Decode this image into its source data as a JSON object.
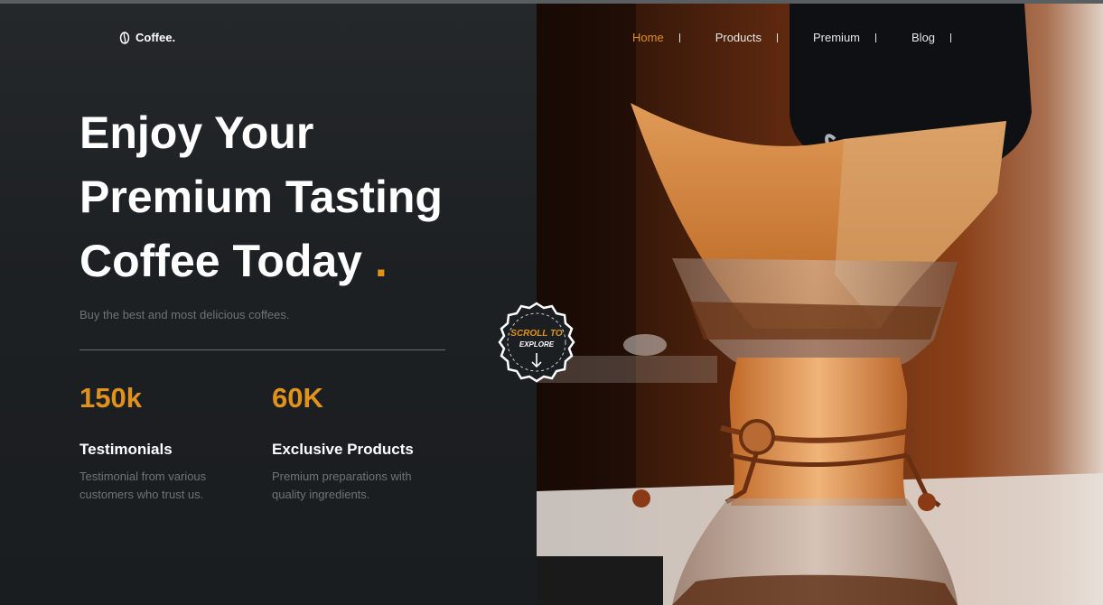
{
  "brand": {
    "name": "Coffee.",
    "icon": "coffee-bean-icon"
  },
  "nav": {
    "items": [
      {
        "label": "Home",
        "active": true
      },
      {
        "label": "Products",
        "active": false
      },
      {
        "label": "Premium",
        "active": false
      },
      {
        "label": "Blog",
        "active": false
      }
    ]
  },
  "hero": {
    "title_lines": [
      "Enjoy Your",
      "Premium Tasting",
      "Coffee Today"
    ],
    "title_dot": ".",
    "subtitle": "Buy the best and most delicious coffees."
  },
  "stats": [
    {
      "value": "150k",
      "label": "Testimonials",
      "description": "Testimonial from various customers who trust us."
    },
    {
      "value": "60K",
      "label": "Exclusive Products",
      "description": "Premium preparations with quality ingredients."
    }
  ],
  "scroll_badge": {
    "line1": "SCROLL TO",
    "line2": "EXPLORE",
    "icon": "arrow-down-icon"
  },
  "colors": {
    "accent": "#e1921c",
    "background": "#1b1e21",
    "text": "#ffffff",
    "muted": "#6f7377"
  }
}
